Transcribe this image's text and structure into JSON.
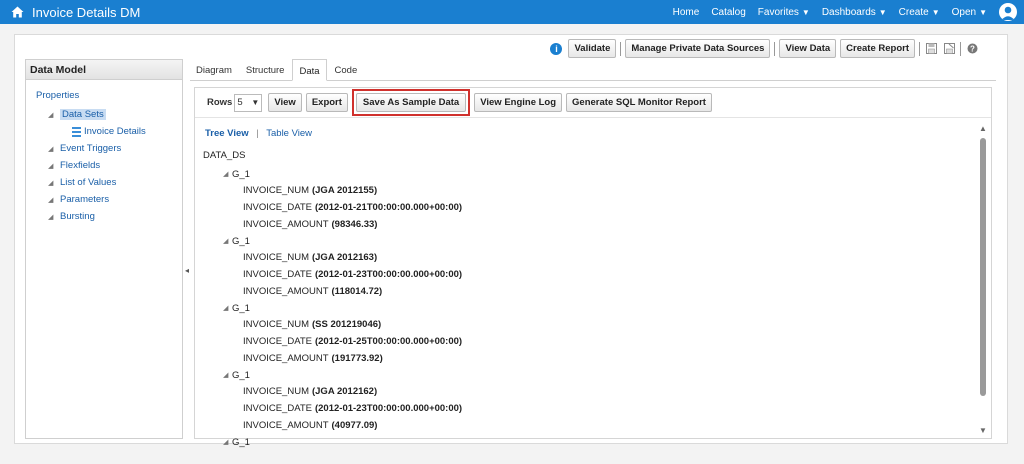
{
  "header": {
    "title": "Invoice Details DM",
    "nav": [
      {
        "label": "Home",
        "caret": false
      },
      {
        "label": "Catalog",
        "caret": false
      },
      {
        "label": "Favorites",
        "caret": true
      },
      {
        "label": "Dashboards",
        "caret": true
      },
      {
        "label": "Create",
        "caret": true
      },
      {
        "label": "Open",
        "caret": true
      }
    ]
  },
  "top_actions": {
    "validate": "Validate",
    "manage_private": "Manage Private Data Sources",
    "view_data": "View Data",
    "create_report": "Create Report"
  },
  "left_panel": {
    "title": "Data Model",
    "root": "Properties",
    "items": {
      "data_sets": "Data Sets",
      "invoice_details": "Invoice Details",
      "event_triggers": "Event Triggers",
      "flexfields": "Flexfields",
      "list_of_values": "List of Values",
      "parameters": "Parameters",
      "bursting": "Bursting"
    }
  },
  "tabs": {
    "diagram": "Diagram",
    "structure": "Structure",
    "data": "Data",
    "code": "Code"
  },
  "toolbar": {
    "rows_label": "Rows",
    "rows_value": "5",
    "view": "View",
    "export": "Export",
    "save_sample": "Save As Sample Data",
    "view_engine_log": "View Engine Log",
    "generate_sql": "Generate SQL Monitor Report"
  },
  "view_switch": {
    "tree": "Tree View",
    "table": "Table View"
  },
  "xml": {
    "root": "DATA_DS",
    "groups": [
      {
        "name": "G_1",
        "fields": [
          {
            "name": "INVOICE_NUM",
            "value": "(JGA 2012155)"
          },
          {
            "name": "INVOICE_DATE",
            "value": "(2012-01-21T00:00:00.000+00:00)"
          },
          {
            "name": "INVOICE_AMOUNT",
            "value": "(98346.33)"
          }
        ]
      },
      {
        "name": "G_1",
        "fields": [
          {
            "name": "INVOICE_NUM",
            "value": "(JGA 2012163)"
          },
          {
            "name": "INVOICE_DATE",
            "value": "(2012-01-23T00:00:00.000+00:00)"
          },
          {
            "name": "INVOICE_AMOUNT",
            "value": "(118014.72)"
          }
        ]
      },
      {
        "name": "G_1",
        "fields": [
          {
            "name": "INVOICE_NUM",
            "value": "(SS 201219046)"
          },
          {
            "name": "INVOICE_DATE",
            "value": "(2012-01-25T00:00:00.000+00:00)"
          },
          {
            "name": "INVOICE_AMOUNT",
            "value": "(191773.92)"
          }
        ]
      },
      {
        "name": "G_1",
        "fields": [
          {
            "name": "INVOICE_NUM",
            "value": "(JGA 2012162)"
          },
          {
            "name": "INVOICE_DATE",
            "value": "(2012-01-23T00:00:00.000+00:00)"
          },
          {
            "name": "INVOICE_AMOUNT",
            "value": "(40977.09)"
          }
        ]
      },
      {
        "name": "G_1",
        "fields": []
      }
    ]
  },
  "colors": {
    "header_blue": "#1a7fd0",
    "link_blue": "#1a5fa8",
    "highlight_red": "#d0312d",
    "selected_bg": "#c8dcf2"
  },
  "icons": {
    "home": "home-icon",
    "user": "user-icon",
    "info": "info-icon",
    "save": "save-icon",
    "save_as": "save-as-icon",
    "help": "help-icon"
  }
}
